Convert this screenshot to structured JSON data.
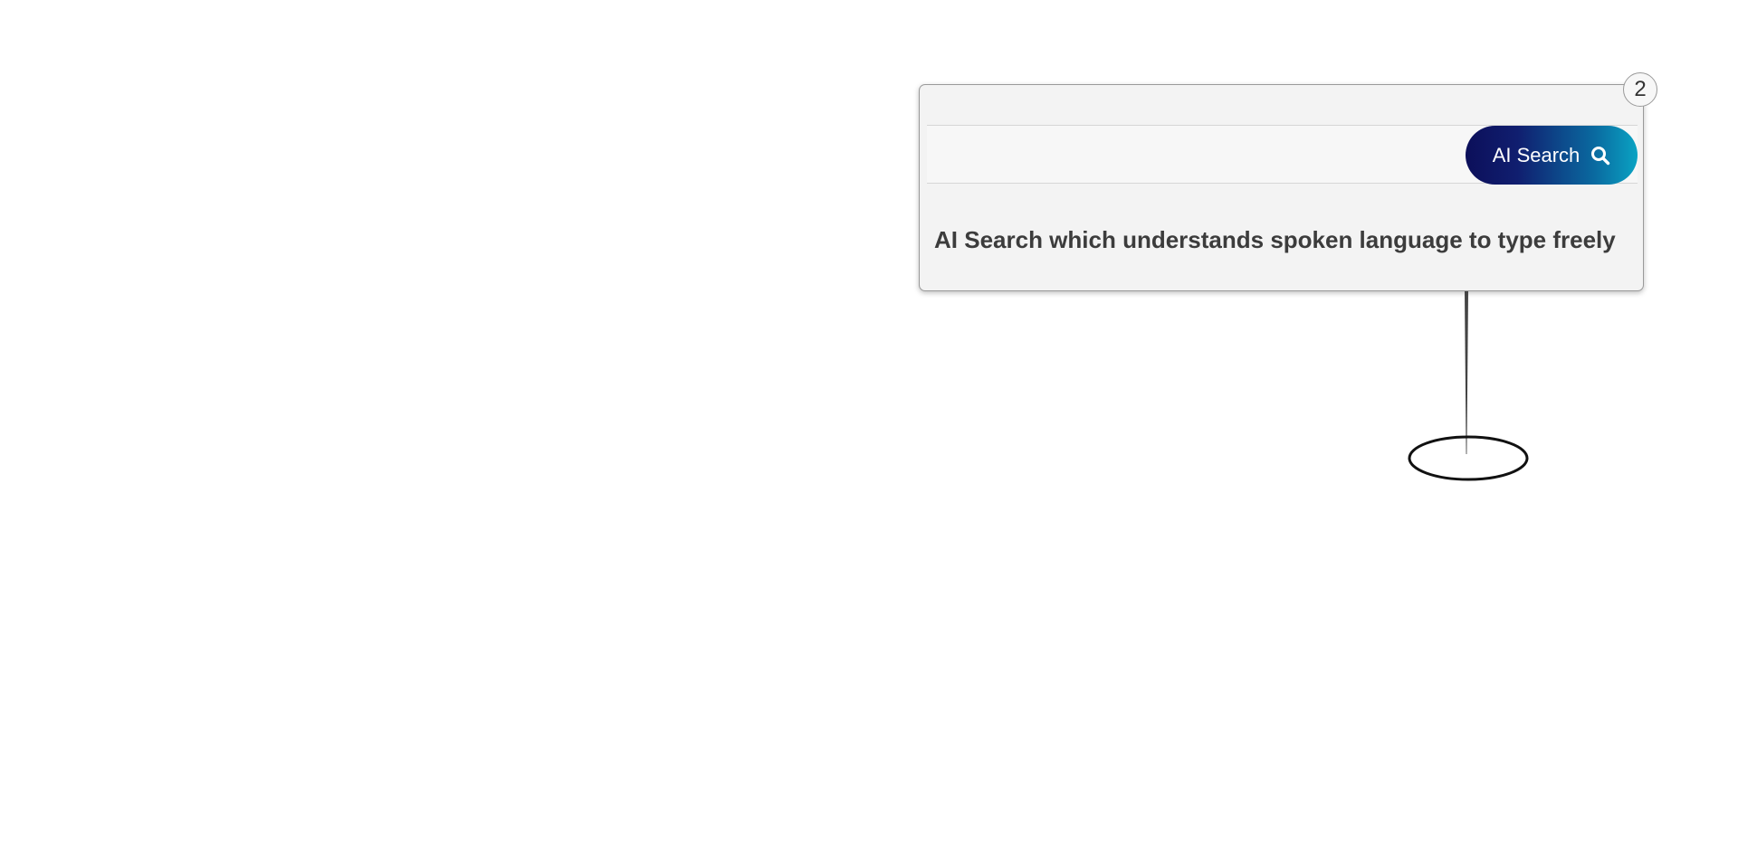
{
  "tour": {
    "step_number": "2",
    "description": "AI Search which understands spoken language to type freely"
  },
  "search": {
    "button_label": "AI Search",
    "button_icon": "search-icon",
    "gradient_start": "#0c0f5a",
    "gradient_end": "#0aa3c3"
  }
}
